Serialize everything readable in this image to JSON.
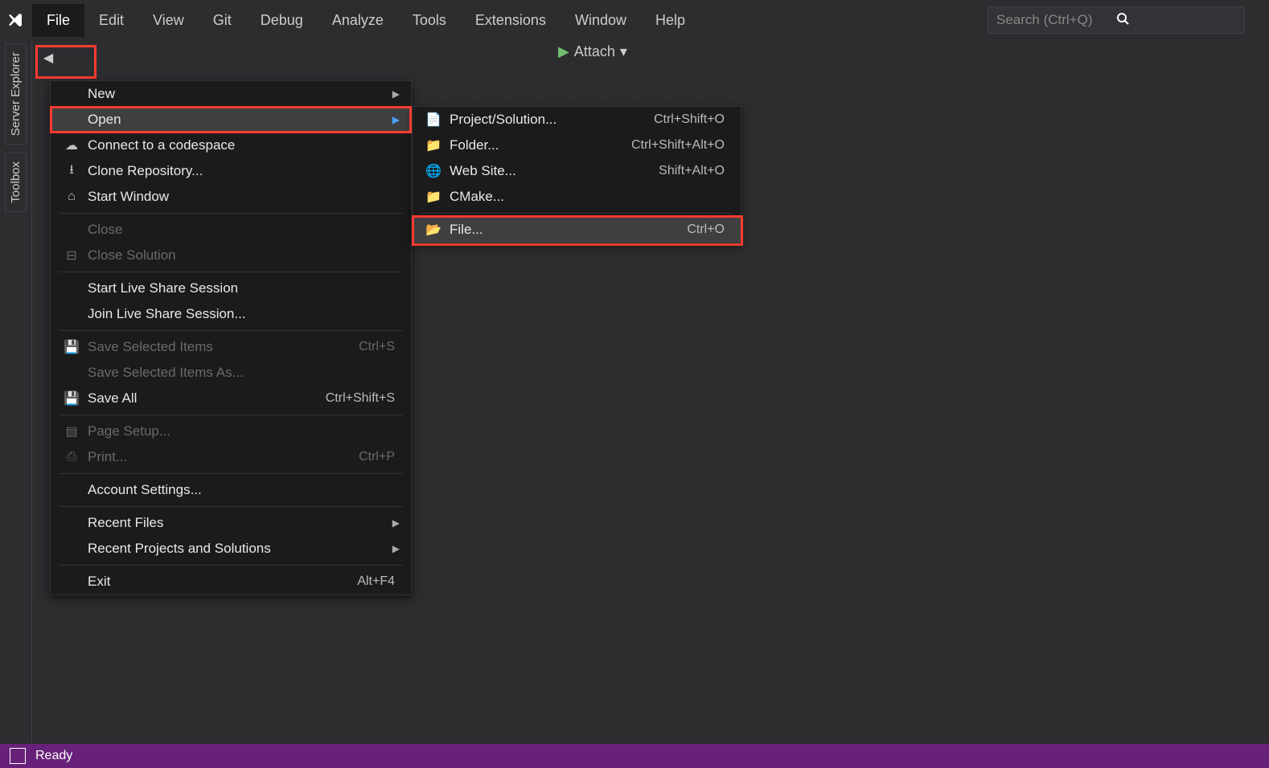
{
  "menubar": {
    "items": [
      "File",
      "Edit",
      "View",
      "Git",
      "Debug",
      "Analyze",
      "Tools",
      "Extensions",
      "Window",
      "Help"
    ]
  },
  "search": {
    "placeholder": "Search (Ctrl+Q)"
  },
  "side_tabs": [
    "Server Explorer",
    "Toolbox"
  ],
  "toolbar": {
    "attach": "Attach"
  },
  "file_menu": {
    "new": "New",
    "open": "Open",
    "connect": "Connect to a codespace",
    "clone": "Clone Repository...",
    "startwin": "Start Window",
    "close": "Close",
    "closesol": "Close Solution",
    "startlive": "Start Live Share Session",
    "joinlive": "Join Live Share Session...",
    "savesel": "Save Selected Items",
    "savesel_sc": "Ctrl+S",
    "saveselas": "Save Selected Items As...",
    "saveall": "Save All",
    "saveall_sc": "Ctrl+Shift+S",
    "pagesetup": "Page Setup...",
    "print": "Print...",
    "print_sc": "Ctrl+P",
    "account": "Account Settings...",
    "recentfiles": "Recent Files",
    "recentproj": "Recent Projects and Solutions",
    "exit": "Exit",
    "exit_sc": "Alt+F4"
  },
  "open_submenu": {
    "proj": "Project/Solution...",
    "proj_sc": "Ctrl+Shift+O",
    "folder": "Folder...",
    "folder_sc": "Ctrl+Shift+Alt+O",
    "website": "Web Site...",
    "website_sc": "Shift+Alt+O",
    "cmake": "CMake...",
    "file": "File...",
    "file_sc": "Ctrl+O"
  },
  "status": {
    "text": "Ready"
  }
}
